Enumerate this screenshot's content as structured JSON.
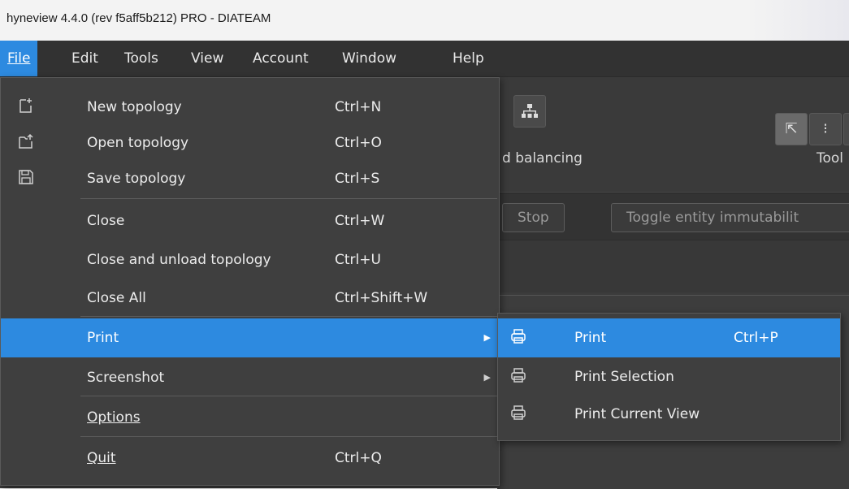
{
  "window": {
    "title": "hyneview 4.4.0 (rev f5aff5b212) PRO - DIATEAM"
  },
  "menubar": {
    "items": [
      {
        "label": "File",
        "active": true
      },
      {
        "label": "Edit"
      },
      {
        "label": "Tools"
      },
      {
        "label": "View"
      },
      {
        "label": "Account"
      },
      {
        "label": "Window"
      },
      {
        "label": "Help"
      }
    ]
  },
  "toolbar": {
    "load_balancing_label": "d balancing",
    "tools_label": "Tool",
    "stop_label": "Stop",
    "toggle_label": "Toggle entity immutabilit"
  },
  "file_menu": {
    "items": [
      {
        "label": "New topology",
        "shortcut": "Ctrl+N",
        "icon": "new-file-icon"
      },
      {
        "label": "Open topology",
        "shortcut": "Ctrl+O",
        "icon": "open-folder-icon"
      },
      {
        "label": "Save topology",
        "shortcut": "Ctrl+S",
        "icon": "save-icon"
      },
      {
        "label": "Close",
        "shortcut": "Ctrl+W"
      },
      {
        "label": "Close and unload topology",
        "shortcut": "Ctrl+U"
      },
      {
        "label": "Close All",
        "shortcut": "Ctrl+Shift+W"
      },
      {
        "label": "Print",
        "shortcut": "",
        "submenu": true,
        "highlighted": true
      },
      {
        "label": "Screenshot",
        "shortcut": "",
        "submenu": true
      },
      {
        "label": "Options",
        "shortcut": ""
      },
      {
        "label": "Quit",
        "shortcut": "Ctrl+Q"
      }
    ]
  },
  "print_submenu": {
    "items": [
      {
        "label": "Print",
        "shortcut": "Ctrl+P",
        "icon": "printer-icon",
        "highlighted": true
      },
      {
        "label": "Print Selection",
        "shortcut": "",
        "icon": "printer-icon"
      },
      {
        "label": "Print Current View",
        "shortcut": "",
        "icon": "printer-icon"
      }
    ]
  },
  "colors": {
    "highlight": "#2d8ae0",
    "menu_bg": "#3f3f3f",
    "app_bg": "#3c3c3c"
  }
}
